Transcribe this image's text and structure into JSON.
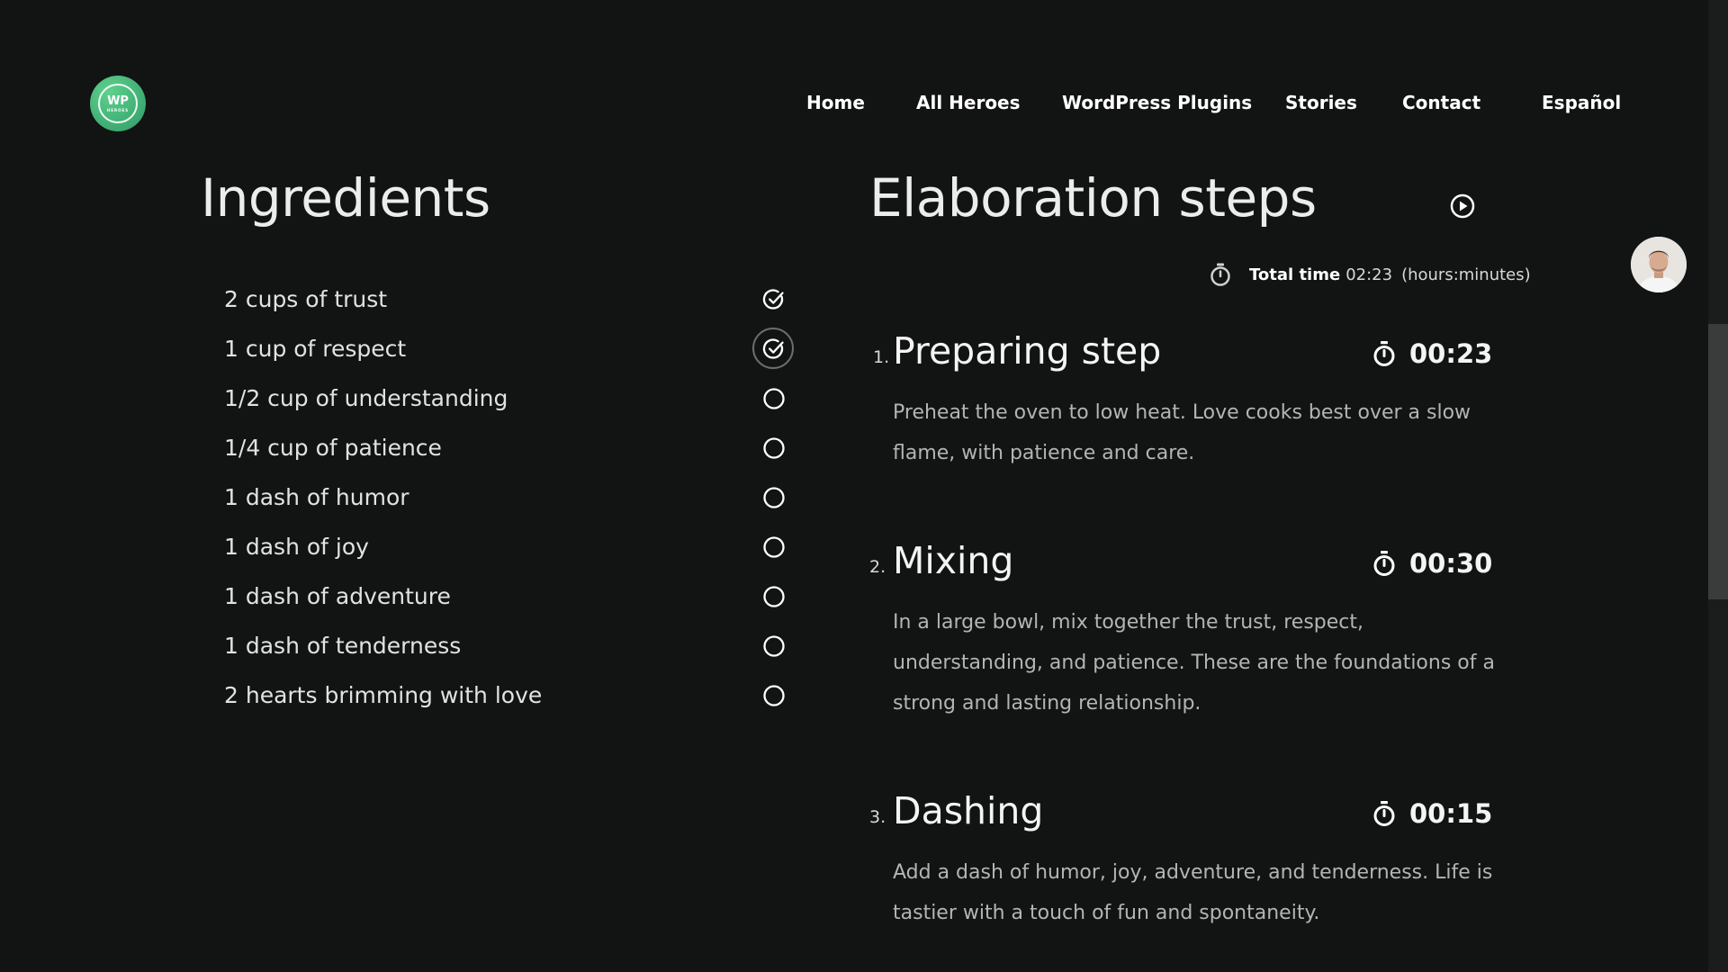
{
  "logo": {
    "text": "WP",
    "subtext": "HEROES"
  },
  "nav": {
    "home": "Home",
    "all_heroes": "All Heroes",
    "plugins": "WordPress Plugins",
    "stories": "Stories",
    "contact": "Contact",
    "language": "Español"
  },
  "ingredients": {
    "title": "Ingredients",
    "items": [
      {
        "label": "2 cups of trust",
        "checked": true
      },
      {
        "label": "1 cup of respect",
        "checked": true
      },
      {
        "label": "1/2 cup of understanding",
        "checked": false
      },
      {
        "label": "1/4 cup of patience",
        "checked": false
      },
      {
        "label": "1 dash of humor",
        "checked": false
      },
      {
        "label": "1 dash of joy",
        "checked": false
      },
      {
        "label": "1 dash of adventure",
        "checked": false
      },
      {
        "label": "1 dash of tenderness",
        "checked": false
      },
      {
        "label": "2 hearts brimming with love",
        "checked": false
      }
    ]
  },
  "steps_section": {
    "title": "Elaboration steps",
    "total_label": "Total time",
    "total_value": "02:23",
    "total_unit": "(hours:minutes)"
  },
  "steps": [
    {
      "number": "1.",
      "title": "Preparing step",
      "time": "00:23",
      "description": "Preheat the oven to low heat. Love cooks best over a slow flame, with patience and care."
    },
    {
      "number": "2.",
      "title": "Mixing",
      "time": "00:30",
      "description": "In a large bowl, mix together the trust, respect, understanding, and patience. These are the foundations of a strong and lasting relationship."
    },
    {
      "number": "3.",
      "title": "Dashing",
      "time": "00:15",
      "description": "Add a dash of humor, joy, adventure, and tenderness. Life is tastier with a touch of fun and spontaneity."
    }
  ],
  "icons": {
    "check": "check-circle-icon",
    "empty": "empty-circle-icon",
    "play": "play-circle-icon",
    "stopwatch": "stopwatch-icon"
  },
  "colors": {
    "background": "#121313",
    "logo": "#3fb47a"
  }
}
